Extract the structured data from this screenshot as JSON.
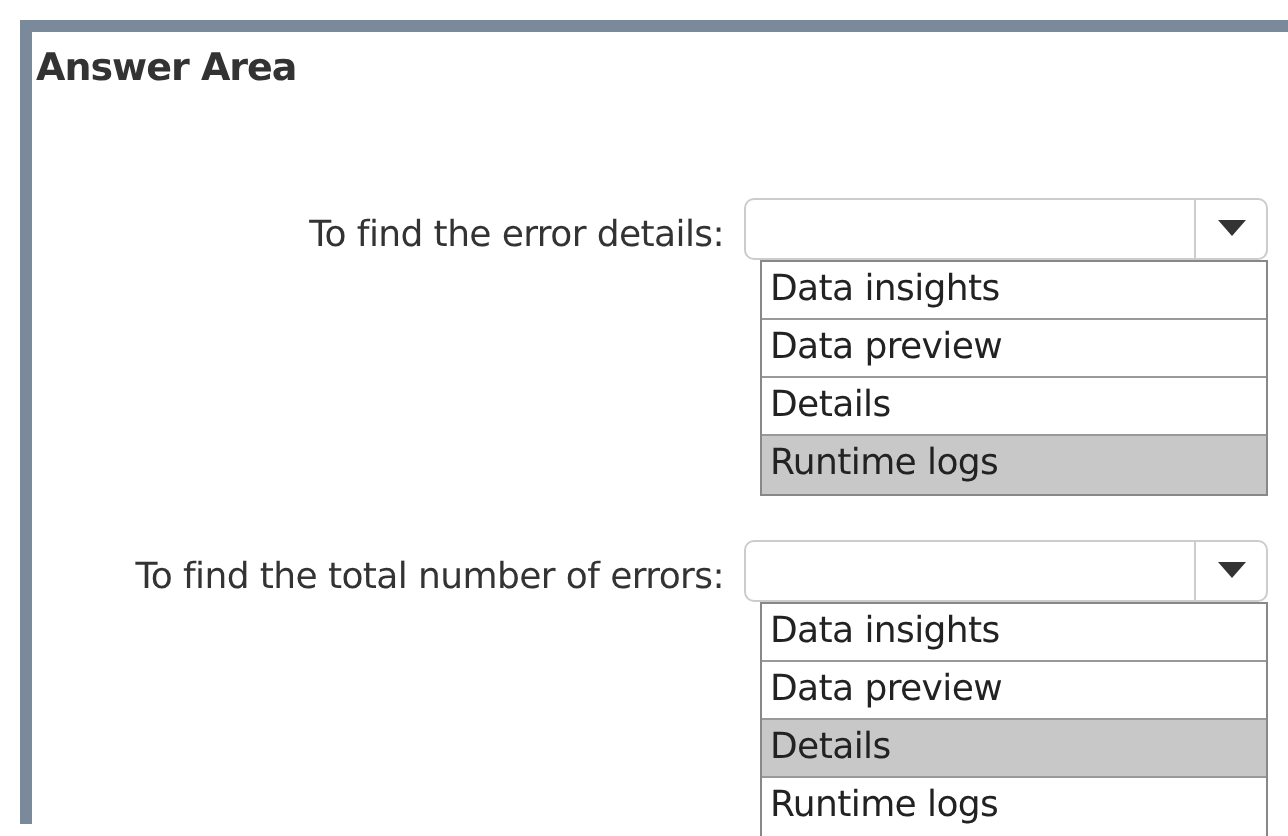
{
  "title": "Answer Area",
  "questions": [
    {
      "label": "To find the error details:",
      "options": [
        {
          "label": "Data insights",
          "selected": false
        },
        {
          "label": "Data preview",
          "selected": false
        },
        {
          "label": "Details",
          "selected": false
        },
        {
          "label": "Runtime logs",
          "selected": true
        }
      ]
    },
    {
      "label": "To find the total number of errors:",
      "options": [
        {
          "label": "Data insights",
          "selected": false
        },
        {
          "label": "Data preview",
          "selected": false
        },
        {
          "label": "Details",
          "selected": true
        },
        {
          "label": "Runtime logs",
          "selected": false
        }
      ]
    }
  ]
}
